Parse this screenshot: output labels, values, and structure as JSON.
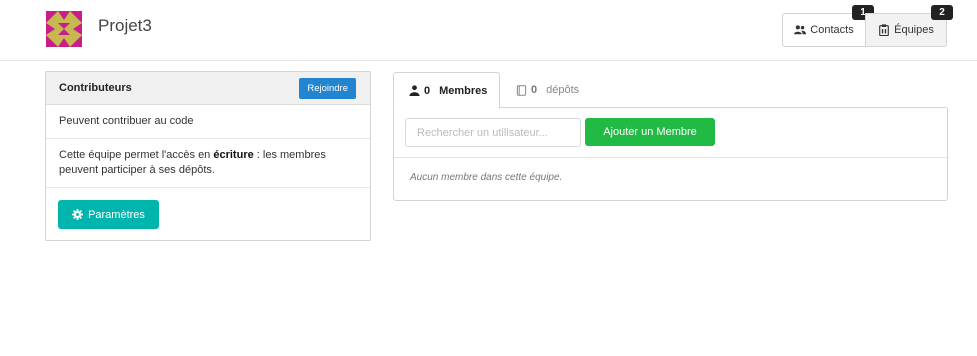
{
  "header": {
    "org_name": "Projet3",
    "avatar_colors": [
      "#c81e8c",
      "#c8b850"
    ],
    "buttons": [
      {
        "label": "Contacts",
        "icon": "users-icon",
        "count": "1"
      },
      {
        "label": "Équipes",
        "icon": "clipboard-icon",
        "count": "2"
      }
    ]
  },
  "team": {
    "title": "Contributeurs",
    "join_label": "Rejoindre",
    "description": "Peuvent contribuer au code",
    "access_prefix": "Cette équipe permet l'accès en ",
    "access_mode": "écriture",
    "access_suffix": " : les membres peuvent participer à ses dépôts.",
    "settings_label": "Paramètres"
  },
  "tabs": [
    {
      "icon": "user-icon",
      "count": "0",
      "label": "Membres",
      "active": true
    },
    {
      "icon": "book-icon",
      "count": "0",
      "label": "dépôts",
      "active": false
    }
  ],
  "members": {
    "search_placeholder": "Rechercher un utilisateur...",
    "add_label": "Ajouter un Membre",
    "empty_message": "Aucun membre dans cette équipe."
  },
  "colors": {
    "primary_blue": "#2185d0",
    "teal": "#00b5ad",
    "green": "#21ba45"
  }
}
